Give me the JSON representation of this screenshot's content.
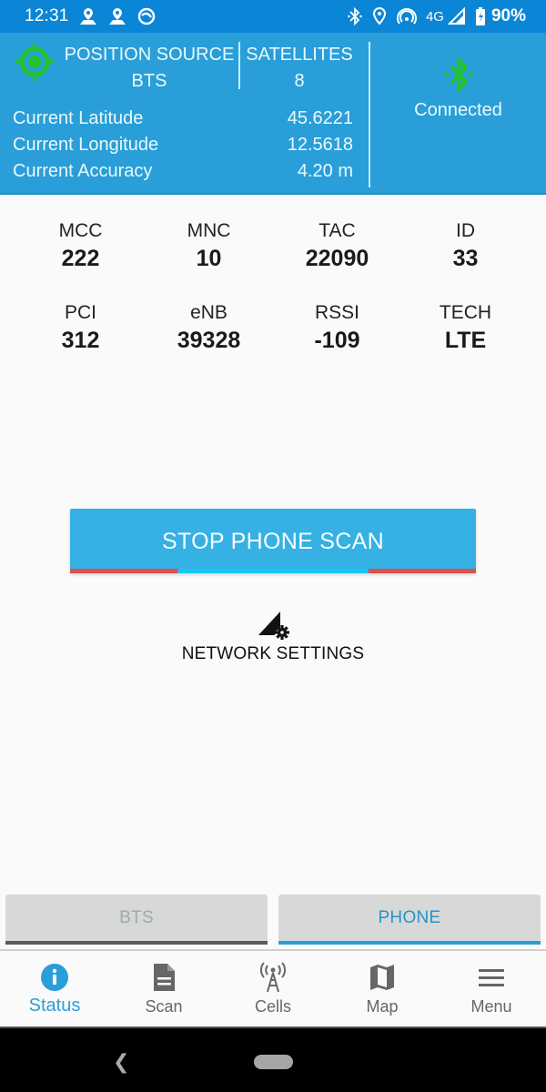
{
  "status_bar": {
    "time": "12:31",
    "network": "4G",
    "battery": "90%",
    "left_icons": [
      "map-pin-icon",
      "map-pin-icon",
      "no-entry-circle-icon"
    ],
    "right_icons": [
      "bluetooth-icon",
      "location-icon",
      "hotspot-icon",
      "cell-signal-icon",
      "battery-charging-icon"
    ]
  },
  "header": {
    "position_source_label": "POSITION SOURCE",
    "position_source_value": "BTS",
    "satellites_label": "SATELLITES",
    "satellites_value": "8",
    "coords": [
      {
        "label": "Current Latitude",
        "value": "45.6221"
      },
      {
        "label": "Current Longitude",
        "value": "12.5618"
      },
      {
        "label": "Current Accuracy",
        "value": "4.20 m"
      }
    ],
    "bluetooth_status": "Connected",
    "gps_icon_color": "#22c22e",
    "bluetooth_icon_color": "#22c22e"
  },
  "cell_info": [
    {
      "key": "MCC",
      "value": "222"
    },
    {
      "key": "MNC",
      "value": "10"
    },
    {
      "key": "TAC",
      "value": "22090"
    },
    {
      "key": "ID",
      "value": "33"
    },
    {
      "key": "PCI",
      "value": "312"
    },
    {
      "key": "eNB",
      "value": "39328"
    },
    {
      "key": "RSSI",
      "value": "-109"
    },
    {
      "key": "TECH",
      "value": "LTE"
    }
  ],
  "scan_button": {
    "label": "STOP PHONE SCAN",
    "progress_indeterminate": true
  },
  "network_settings": {
    "label": "NETWORK SETTINGS"
  },
  "source_toggle": {
    "options": [
      "BTS",
      "PHONE"
    ],
    "selected": "PHONE"
  },
  "bottom_nav": {
    "items": [
      {
        "label": "Status",
        "icon": "info-icon",
        "active": true
      },
      {
        "label": "Scan",
        "icon": "document-icon",
        "active": false
      },
      {
        "label": "Cells",
        "icon": "cell-tower-icon",
        "active": false
      },
      {
        "label": "Map",
        "icon": "map-icon",
        "active": false
      },
      {
        "label": "Menu",
        "icon": "menu-icon",
        "active": false
      }
    ]
  },
  "colors": {
    "status_bar": "#0b86d6",
    "header": "#2a9ed8",
    "accent": "#2a9ed8",
    "button": "#35b1e4",
    "progress_track": "#df5050",
    "progress_fill": "#12c8f2"
  }
}
